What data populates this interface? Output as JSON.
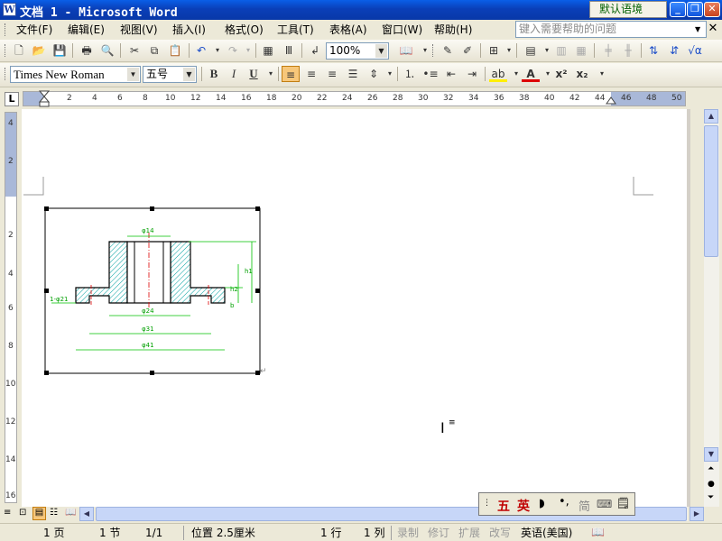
{
  "window": {
    "title": "文档 1 - Microsoft Word",
    "language_mode": "默认语境"
  },
  "menu": {
    "items": [
      "文件(F)",
      "编辑(E)",
      "视图(V)",
      "插入(I)",
      "格式(O)",
      "工具(T)",
      "表格(A)",
      "窗口(W)",
      "帮助(H)"
    ],
    "help_placeholder": "键入需要帮助的问题"
  },
  "toolbar": {
    "zoom": "100%"
  },
  "format": {
    "font": "Times New Roman",
    "size": "五号",
    "bold": "B",
    "italic": "I",
    "underline": "U",
    "superscript": "x²",
    "subscript": "x₂"
  },
  "ruler": {
    "h_ticks": [
      "2",
      "2",
      "4",
      "6",
      "8",
      "10",
      "12",
      "14",
      "16",
      "18",
      "20",
      "22",
      "24",
      "26",
      "28",
      "30",
      "32",
      "34",
      "36",
      "38",
      "40",
      "42",
      "44",
      "46",
      "48",
      "50"
    ],
    "v_ticks": [
      "4",
      "2",
      "2",
      "4",
      "6",
      "8",
      "10",
      "12",
      "14",
      "16"
    ]
  },
  "drawing": {
    "labels": [
      "φ14",
      "φ24",
      "φ31",
      "φ41",
      "1-φ21",
      "h1",
      "h2",
      "b"
    ]
  },
  "status": {
    "page": "1 页",
    "section": "1 节",
    "page_of": "1/1",
    "position": "位置 2.5厘米",
    "line": "1 行",
    "col": "1 列",
    "rec": "录制",
    "trk": "修订",
    "ext": "扩展",
    "ovr": "改写",
    "lang": "英语(美国)"
  },
  "ime": {
    "cn": "五",
    "en": "英",
    "simp": "简"
  }
}
